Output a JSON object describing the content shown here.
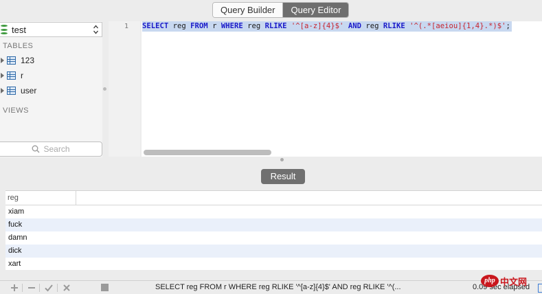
{
  "toolbar": {
    "tabs": [
      {
        "label": "Query Builder",
        "active": false
      },
      {
        "label": "Query Editor",
        "active": true
      }
    ]
  },
  "sidebar": {
    "database": "test",
    "tables_label": "TABLES",
    "tables": [
      {
        "name": "123"
      },
      {
        "name": "r"
      },
      {
        "name": "user"
      }
    ],
    "views_label": "VIEWS",
    "search_placeholder": "Search"
  },
  "editor": {
    "line_number": "1",
    "tokens": [
      {
        "t": "SELECT",
        "k": "kw"
      },
      {
        "t": " reg ",
        "k": "id"
      },
      {
        "t": "FROM",
        "k": "kw"
      },
      {
        "t": " r ",
        "k": "id"
      },
      {
        "t": "WHERE",
        "k": "kw"
      },
      {
        "t": " reg ",
        "k": "id"
      },
      {
        "t": "RLIKE",
        "k": "kw"
      },
      {
        "t": " ",
        "k": "id"
      },
      {
        "t": "'^[a-z]{4}$'",
        "k": "str"
      },
      {
        "t": " ",
        "k": "id"
      },
      {
        "t": "AND",
        "k": "kw"
      },
      {
        "t": " reg ",
        "k": "id"
      },
      {
        "t": "RLIKE",
        "k": "kw"
      },
      {
        "t": " ",
        "k": "id"
      },
      {
        "t": "'^(.*[aeiou]{1,4}.*)$'",
        "k": "str"
      },
      {
        "t": ";",
        "k": "id"
      }
    ]
  },
  "result": {
    "button_label": "Result",
    "column": "reg",
    "rows": [
      "xiam",
      "fuck",
      "damn",
      "dick",
      "xart"
    ]
  },
  "status": {
    "query": "SELECT reg FROM r WHERE reg RLIKE '^[a-z]{4}$' AND reg RLIKE '^(...",
    "elapsed": "0.09 sec elapsed"
  },
  "watermark": {
    "badge": "php",
    "text": "中文网"
  },
  "colors": {
    "keyword": "#1b1bc9",
    "string": "#c7252e",
    "selection": "#c8d8f0",
    "row_alt": "#eaf0fa"
  }
}
